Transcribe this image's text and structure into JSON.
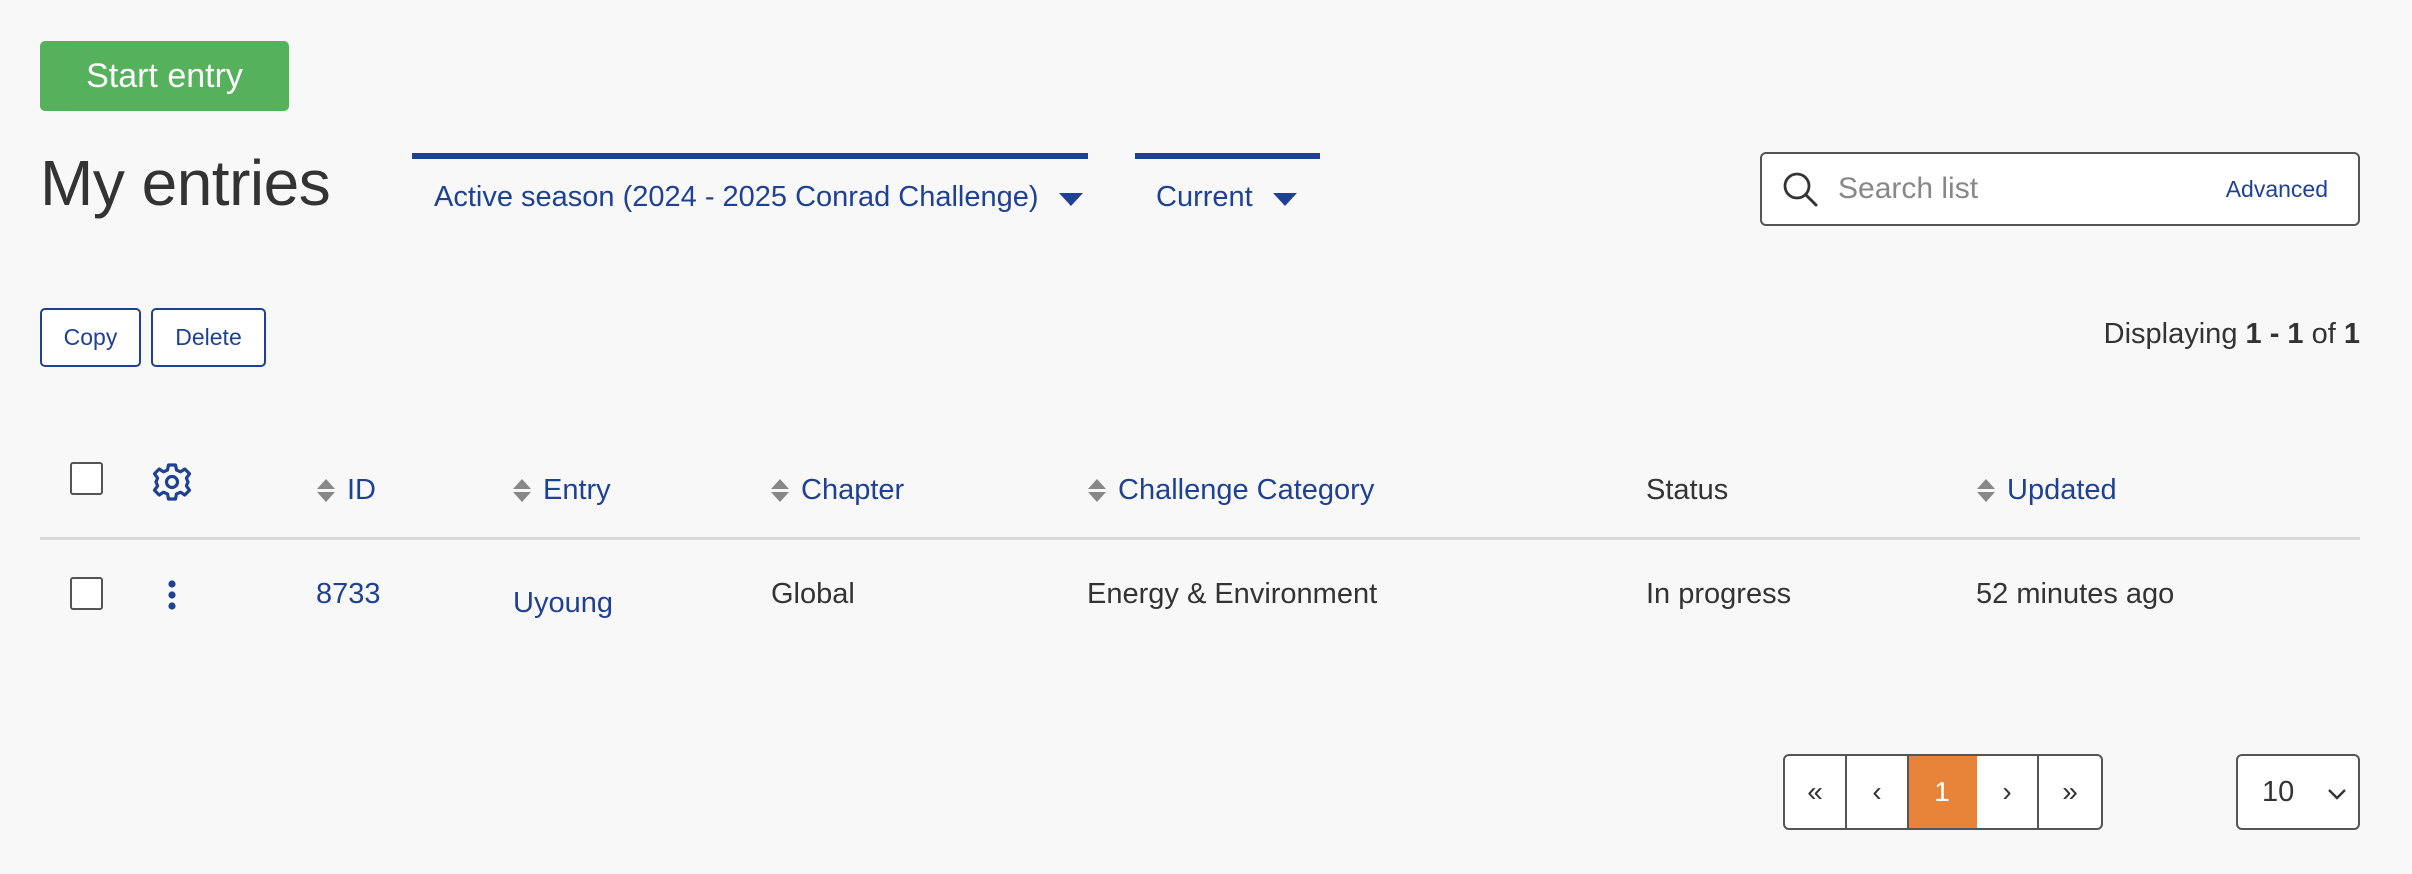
{
  "actions": {
    "start_entry_label": "Start entry",
    "copy_label": "Copy",
    "delete_label": "Delete"
  },
  "page": {
    "title": "My entries"
  },
  "filters": {
    "season": "Active season (2024 - 2025 Conrad Challenge)",
    "status": "Current"
  },
  "search": {
    "placeholder": "Search list",
    "advanced_label": "Advanced"
  },
  "summary": {
    "prefix": "Displaying",
    "range": "1 - 1",
    "of_label": "of",
    "total": "1"
  },
  "table": {
    "columns": {
      "settings_icon": "gear-icon",
      "id": "ID",
      "entry": "Entry",
      "chapter": "Chapter",
      "category": "Challenge Category",
      "status": "Status",
      "updated": "Updated"
    },
    "rows": [
      {
        "row_menu_icon": "kebab-menu-icon",
        "id": "8733",
        "entry": "Uyoung",
        "chapter": "Global",
        "category": "Energy & Environment",
        "status": "In progress",
        "updated": "52 minutes ago"
      }
    ]
  },
  "pagination": {
    "first": "«",
    "prev": "‹",
    "current": "1",
    "next": "›",
    "last": "»"
  },
  "per_page": {
    "value": "10"
  },
  "colors": {
    "accent_blue": "#1f4193",
    "start_green": "#56b15c",
    "active_page_orange": "#e8833a",
    "background": "#f8f8f8"
  }
}
